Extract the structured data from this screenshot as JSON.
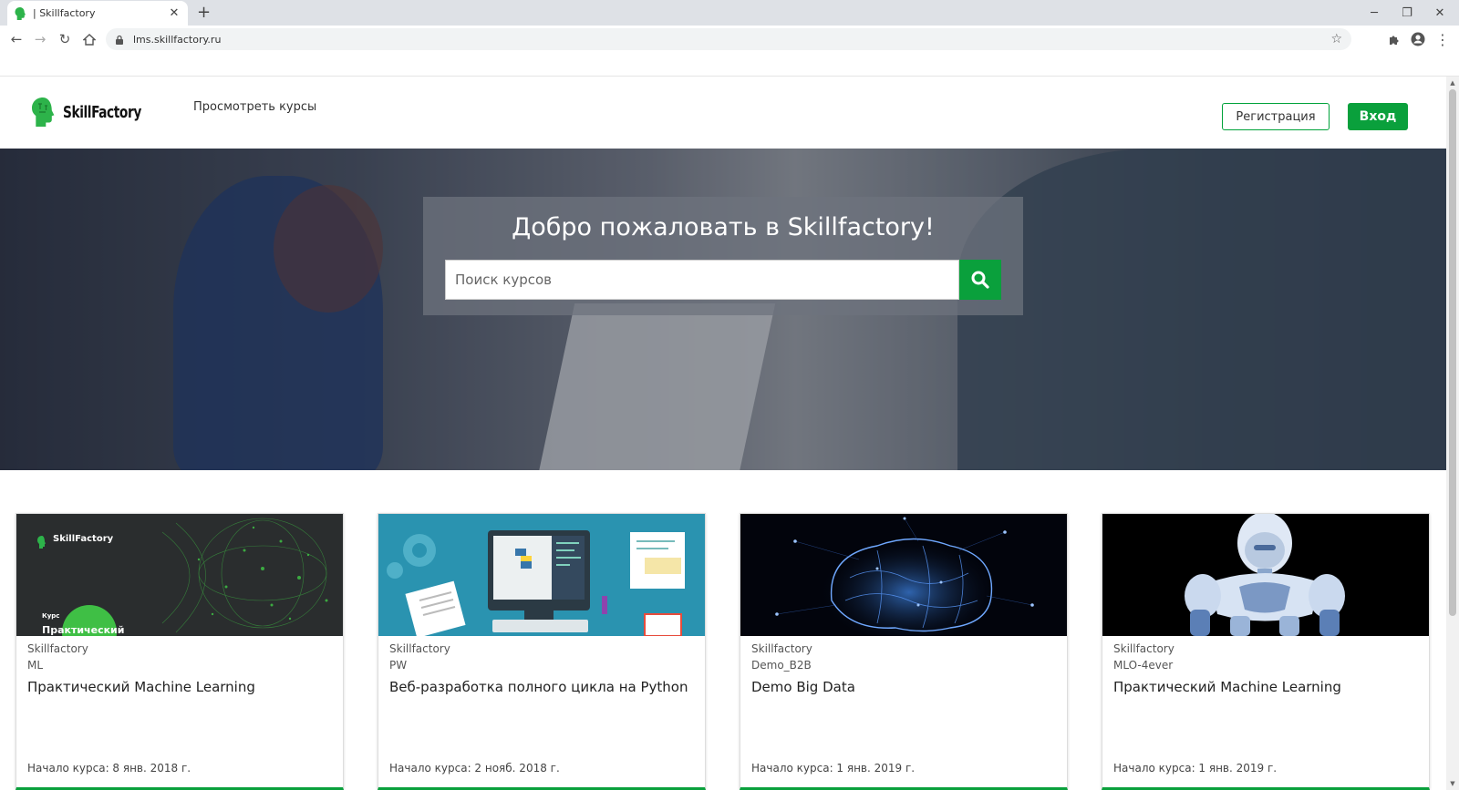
{
  "browser": {
    "tab_title": "| Skillfactory",
    "url": "lms.skillfactory.ru"
  },
  "header": {
    "logo_text": "SkillFactory",
    "browse_link": "Просмотреть курсы",
    "register_label": "Регистрация",
    "login_label": "Вход"
  },
  "hero": {
    "title": "Добро пожаловать в Skillfactory!",
    "search_placeholder": "Поиск курсов"
  },
  "courses": [
    {
      "org": "Skillfactory",
      "code": "ML",
      "title": "Практический Machine Learning",
      "start": "Начало курса: 8 янв. 2018 г.",
      "thumb_logo": "SkillFactory",
      "thumb_kicker": "Курс",
      "thumb_caption": "Практический"
    },
    {
      "org": "Skillfactory",
      "code": "PW",
      "title": "Веб-разработка полного цикла на Python",
      "start": "Начало курса: 2 нояб. 2018 г."
    },
    {
      "org": "Skillfactory",
      "code": "Demo_B2B",
      "title": "Demo Big Data",
      "start": "Начало курса: 1 янв. 2019 г."
    },
    {
      "org": "Skillfactory",
      "code": "MLO-4ever",
      "title": "Практический Machine Learning",
      "start": "Начало курса: 1 янв. 2019 г."
    }
  ],
  "colors": {
    "accent_green": "#0aa03c"
  }
}
